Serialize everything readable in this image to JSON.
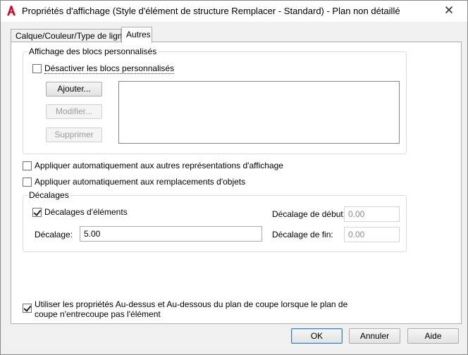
{
  "window": {
    "title": "Propriétés d'affichage (Style d'élément de structure Remplacer - Standard) - Plan non détaillé",
    "app_icon": "autocad-a-icon",
    "close_icon": "close-icon",
    "accent_color": "#c8102e"
  },
  "tabs": [
    {
      "label": "Calque/Couleur/Type de ligne",
      "active": false
    },
    {
      "label": "Autres",
      "active": true
    }
  ],
  "custom_blocks": {
    "group_title": "Affichage des blocs personnalisés",
    "disable_label": "Désactiver les blocs personnalisés",
    "disable_checked": false,
    "add_label": "Ajouter...",
    "modify_label": "Modifier...",
    "delete_label": "Supprimer",
    "modify_enabled": false,
    "delete_enabled": false,
    "list_items": []
  },
  "options": {
    "apply_display_reps_label": "Appliquer automatiquement aux autres représentations d'affichage",
    "apply_display_reps_checked": false,
    "apply_overrides_label": "Appliquer automatiquement aux remplacements d'objets",
    "apply_overrides_checked": false
  },
  "offsets": {
    "group_title": "Décalages",
    "element_offsets_label": "Décalages d'éléments",
    "element_offsets_checked": true,
    "offset_label": "Décalage:",
    "offset_value": "5.00",
    "start_offset_label": "Décalage de début:",
    "start_offset_value": "0.00",
    "end_offset_label": "Décalage de fin:",
    "end_offset_value": "0.00"
  },
  "cut_plane": {
    "label_line1": "Utiliser les propriétés Au-dessus et Au-dessous du plan de coupe lorsque le plan de",
    "label_line2": "coupe n'entrecoupe pas l'élément",
    "checked": true
  },
  "footer": {
    "ok_label": "OK",
    "cancel_label": "Annuler",
    "help_label": "Aide"
  }
}
